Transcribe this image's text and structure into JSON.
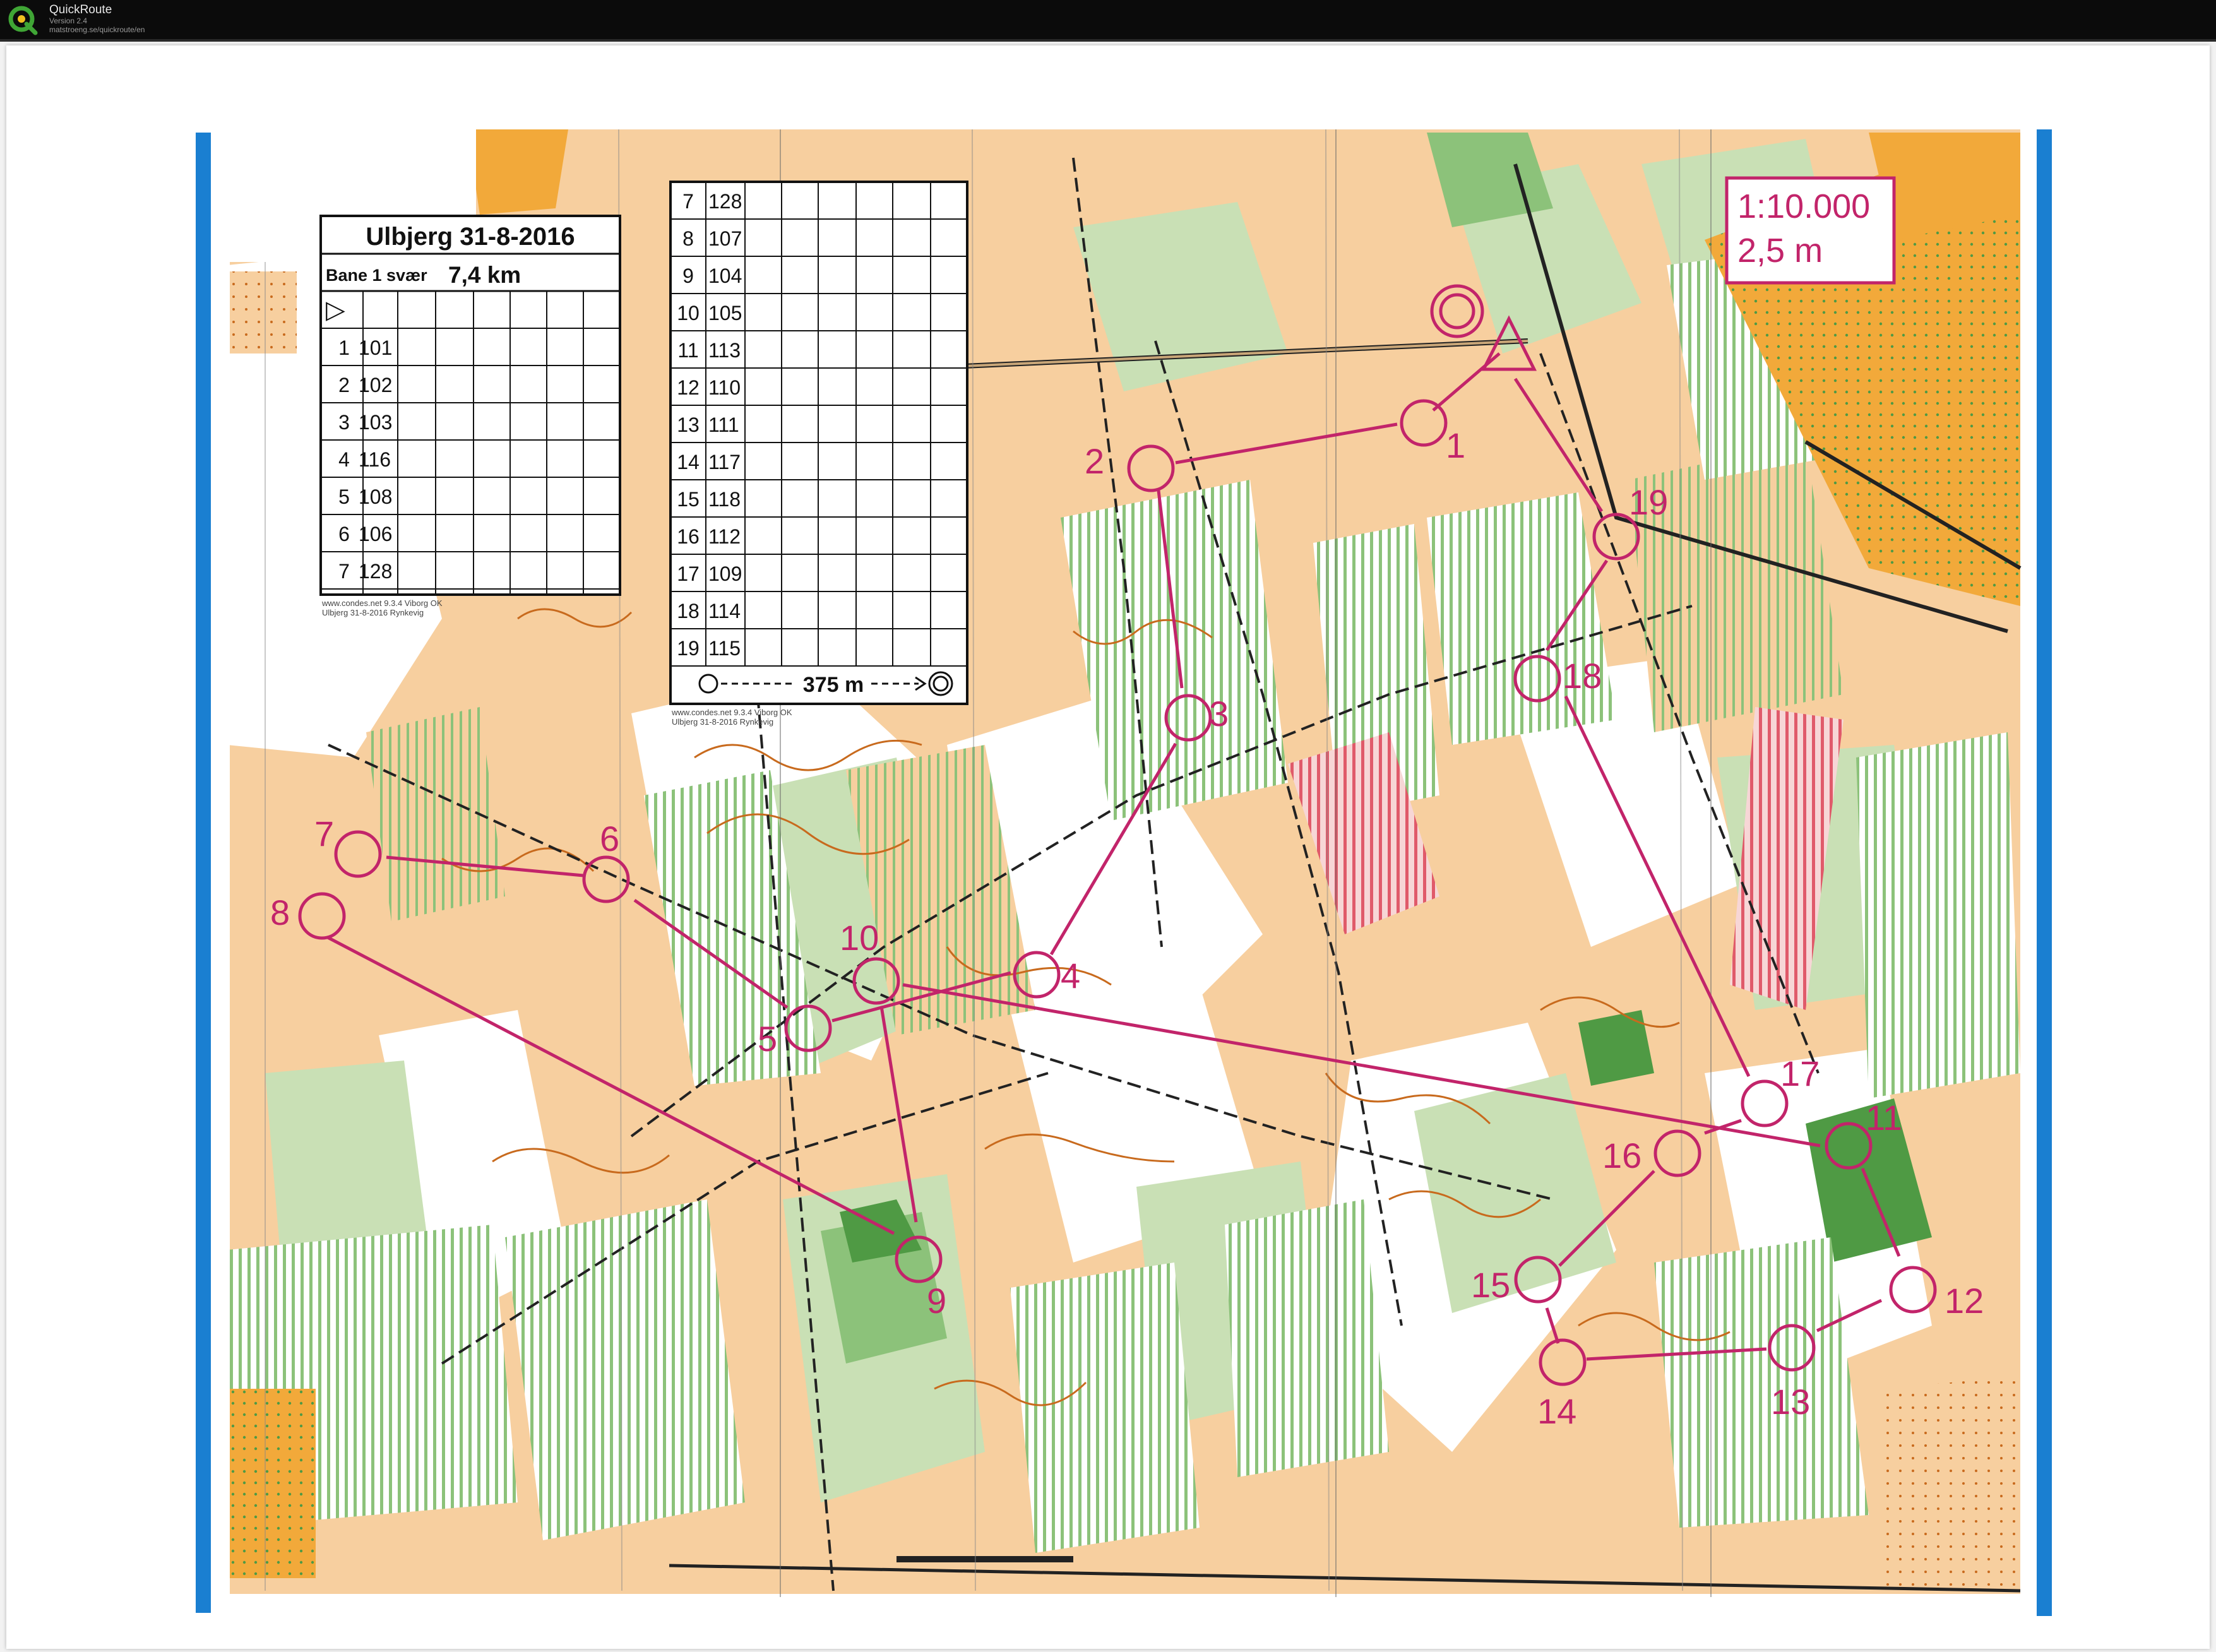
{
  "app": {
    "title": "QuickRoute",
    "version": "Version 2.4",
    "url": "matstroeng.se/quickroute/en"
  },
  "scale_box": {
    "scale": "1:10.000",
    "contour": "2,5 m"
  },
  "legend1": {
    "title": "Ulbjerg 31-8-2016",
    "course": "Bane 1 svær",
    "length": "7,4 km",
    "start_symbol": "▷",
    "rows": [
      {
        "n": "1",
        "code": "101"
      },
      {
        "n": "2",
        "code": "102"
      },
      {
        "n": "3",
        "code": "103"
      },
      {
        "n": "4",
        "code": "116"
      },
      {
        "n": "5",
        "code": "108"
      },
      {
        "n": "6",
        "code": "106"
      },
      {
        "n": "7",
        "code": "128"
      }
    ],
    "footer1": "www.condes.net 9.3.4 Viborg OK",
    "footer2": "Ulbjerg 31-8-2016 Rynkevig"
  },
  "legend2": {
    "rows": [
      {
        "n": "7",
        "code": "128"
      },
      {
        "n": "8",
        "code": "107"
      },
      {
        "n": "9",
        "code": "104"
      },
      {
        "n": "10",
        "code": "105"
      },
      {
        "n": "11",
        "code": "113"
      },
      {
        "n": "12",
        "code": "110"
      },
      {
        "n": "13",
        "code": "111"
      },
      {
        "n": "14",
        "code": "117"
      },
      {
        "n": "15",
        "code": "118"
      },
      {
        "n": "16",
        "code": "112"
      },
      {
        "n": "17",
        "code": "109"
      },
      {
        "n": "18",
        "code": "114"
      },
      {
        "n": "19",
        "code": "115"
      }
    ],
    "finish_text": "375 m",
    "footer1": "www.condes.net 9.3.4 Viborg OK",
    "footer2": "Ulbjerg 31-8-2016 Rynkevig"
  },
  "controls": [
    {
      "label": "1"
    },
    {
      "label": "2"
    },
    {
      "label": "3"
    },
    {
      "label": "4"
    },
    {
      "label": "5"
    },
    {
      "label": "6"
    },
    {
      "label": "7"
    },
    {
      "label": "8"
    },
    {
      "label": "9"
    },
    {
      "label": "10"
    },
    {
      "label": "11"
    },
    {
      "label": "12"
    },
    {
      "label": "13"
    },
    {
      "label": "14"
    },
    {
      "label": "15"
    },
    {
      "label": "16"
    },
    {
      "label": "17"
    },
    {
      "label": "18"
    },
    {
      "label": "19"
    }
  ],
  "colors": {
    "course": "#c2246a",
    "border": "#1a7fd1",
    "open_land": "#f7cf9f",
    "rough_open": "#f2a93a",
    "green_light": "#c9e0b5",
    "green_mid": "#8cc27a",
    "green_dark": "#4f9a44",
    "contour": "#c86a1d",
    "out_of_bounds": "#e05a6a"
  }
}
